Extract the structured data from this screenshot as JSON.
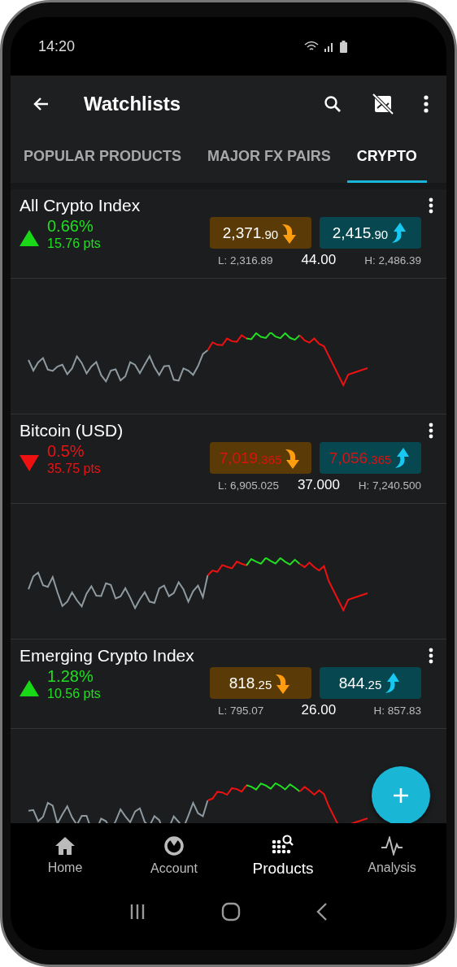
{
  "status_bar": {
    "time": "14:20"
  },
  "app_bar": {
    "title": "Watchlists"
  },
  "tabs": [
    {
      "label": "POPULAR PRODUCTS",
      "selected": false
    },
    {
      "label": "MAJOR FX PAIRS",
      "selected": false
    },
    {
      "label": "CRYPTO",
      "selected": true
    }
  ],
  "instruments": [
    {
      "name": "All Crypto Index",
      "rising": true,
      "change_percent": "0.66%",
      "change_points": "15.76 pts",
      "prices_flash_red": false,
      "sell": {
        "main": "2,371",
        "fraction": ".90"
      },
      "buy": {
        "main": "2,415",
        "fraction": ".90"
      },
      "low": "L: 2,316.89",
      "spread": "44.00",
      "high": "H: 2,486.39"
    },
    {
      "name": "Bitcoin (USD)",
      "rising": false,
      "change_percent": "0.5%",
      "change_points": "35.75 pts",
      "prices_flash_red": true,
      "sell": {
        "main": "7,019",
        "fraction": ".365"
      },
      "buy": {
        "main": "7,056",
        "fraction": ".365"
      },
      "low": "L: 6,905.025",
      "spread": "37.000",
      "high": "H: 7,240.500"
    },
    {
      "name": "Emerging Crypto Index",
      "rising": true,
      "change_percent": "1.28%",
      "change_points": "10.56 pts",
      "prices_flash_red": false,
      "sell": {
        "main": "818",
        "fraction": ".25"
      },
      "buy": {
        "main": "844",
        "fraction": ".25"
      },
      "low": "L: 795.07",
      "spread": "26.00",
      "high": "H: 857.83"
    }
  ],
  "bottom_nav": [
    {
      "label": "Home",
      "kind": "home",
      "selected": false
    },
    {
      "label": "Account",
      "kind": "account",
      "selected": false
    },
    {
      "label": "Products",
      "kind": "products",
      "selected": true
    },
    {
      "label": "Analysis",
      "kind": "analysis",
      "selected": false
    }
  ]
}
